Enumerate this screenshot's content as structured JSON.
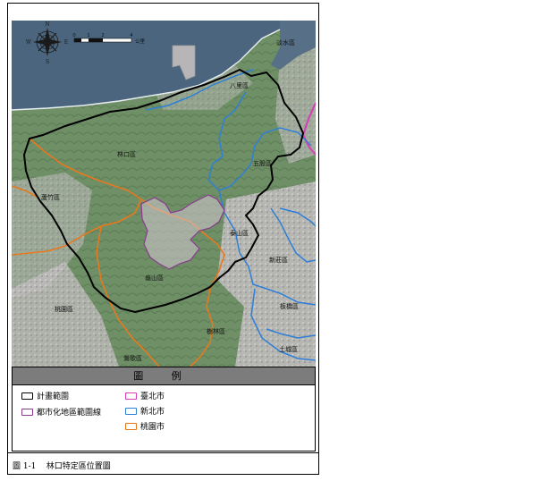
{
  "map": {
    "compass": {
      "n": "N",
      "s": "S",
      "e": "E",
      "w": "W"
    },
    "scale": {
      "ticks": [
        "0",
        "1",
        "2",
        "4"
      ],
      "unit": "公里"
    },
    "district_labels": [
      {
        "key": "tamsui",
        "text": "淡水區"
      },
      {
        "key": "bali",
        "text": "八里區"
      },
      {
        "key": "linkou",
        "text": "林口區"
      },
      {
        "key": "wugu",
        "text": "五股區"
      },
      {
        "key": "luzhu",
        "text": "蘆竹區"
      },
      {
        "key": "taishan",
        "text": "泰山區"
      },
      {
        "key": "xinzhuang",
        "text": "新莊區"
      },
      {
        "key": "guishan",
        "text": "龜山區"
      },
      {
        "key": "taoyuan",
        "text": "桃園區"
      },
      {
        "key": "banqiao",
        "text": "板橋區"
      },
      {
        "key": "shulin",
        "text": "樹林區"
      },
      {
        "key": "tucheng",
        "text": "土城區"
      },
      {
        "key": "yingge",
        "text": "鶯歌區"
      }
    ],
    "colors": {
      "plan_boundary": "#000000",
      "urban_boundary": "#8a3a8f",
      "taipei": "#d93bb8",
      "new_taipei": "#2f7fd6",
      "taoyuan": "#e8781e",
      "sea": "#46617a",
      "terrain": "#6f8f63",
      "urban": "#c9c3c6"
    }
  },
  "legend": {
    "title": "圖 例",
    "items": [
      {
        "label": "計畫範圍",
        "color": "#000000"
      },
      {
        "label": "都市化地區範圍線",
        "color": "#8a3a8f"
      },
      {
        "label": "臺北市",
        "color": "#d93bb8"
      },
      {
        "label": "新北市",
        "color": "#2f7fd6"
      },
      {
        "label": "桃園市",
        "color": "#e8781e"
      }
    ]
  },
  "caption": "圖 1-1    林口特定區位置圖"
}
